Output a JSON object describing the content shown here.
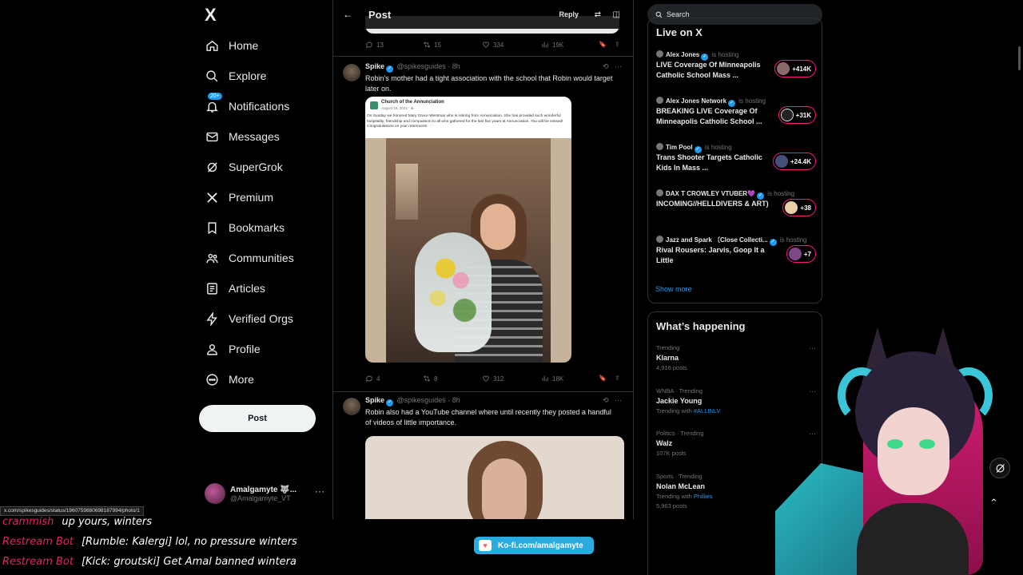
{
  "nav": {
    "logo": "X",
    "items": [
      {
        "label": "Home",
        "icon": "home-icon"
      },
      {
        "label": "Explore",
        "icon": "search-icon"
      },
      {
        "label": "Notifications",
        "icon": "bell-icon",
        "badge": "20+"
      },
      {
        "label": "Messages",
        "icon": "mail-icon"
      },
      {
        "label": "SuperGrok",
        "icon": "grok-icon"
      },
      {
        "label": "Premium",
        "icon": "x-icon"
      },
      {
        "label": "Bookmarks",
        "icon": "bookmark-icon"
      },
      {
        "label": "Communities",
        "icon": "people-icon"
      },
      {
        "label": "Articles",
        "icon": "article-icon"
      },
      {
        "label": "Verified Orgs",
        "icon": "bolt-icon"
      },
      {
        "label": "Profile",
        "icon": "person-icon"
      },
      {
        "label": "More",
        "icon": "more-circle-icon"
      }
    ],
    "post_button": "Post",
    "account": {
      "name": "Amalgamyte 🐺...",
      "handle": "@Amalgamyte_VT"
    }
  },
  "timeline": {
    "title": "Post",
    "reply_label": "Reply",
    "prev_actions": {
      "replies": "13",
      "reposts": "15",
      "likes": "334",
      "views": "19K"
    },
    "tweets": [
      {
        "name": "Spike",
        "handle": "@spikesguides",
        "time": "8h",
        "text": "Robin's mother had a tight association with the school that Robin would target later on.",
        "card": {
          "org": "Church of the Annunciation",
          "date": "August 16, 2021 · ⊕",
          "text": "On Sunday we honored Mary Grace Westman who is retiring from Annunciation. She has provided such wonderful hospitality, friendship and compassion to all who gathered for the last five years at Annunciation. You will be missed! Congratulations on your retirement!"
        },
        "actions": {
          "replies": "4",
          "reposts": "8",
          "likes": "312",
          "views": "18K"
        }
      },
      {
        "name": "Spike",
        "handle": "@spikesguides",
        "time": "8h",
        "text": "Robin also had a YouTube channel where until recently they posted a handful of videos of little importance."
      }
    ]
  },
  "right": {
    "search_placeholder": "Search",
    "live_title": "Live on X",
    "live": [
      {
        "host": "Alex Jones",
        "status": "is hosting",
        "title": "LIVE Coverage Of Minneapolis Catholic School Mass ...",
        "count": "+414K"
      },
      {
        "host": "Alex Jones Network",
        "status": "is hosting",
        "title": "BREAKING LIVE Coverage Of Minneapolis Catholic School ...",
        "count": "+31K"
      },
      {
        "host": "Tim Pool",
        "status": "is hosting",
        "title": "Trans Shooter Targets Catholic Kids In Mass ...",
        "count": "+24.4K"
      },
      {
        "host": "DAX T CROWLEY VTUBER💜",
        "status": "is hosting",
        "title": "INCOMING//HELLDIVERS & ART)",
        "count": "+38"
      },
      {
        "host": "Jazz and Spark 〔Close Collecti...",
        "status": "is hosting",
        "title": "Rival Rousers: Jarvis, Goop It a Little",
        "count": "+7"
      }
    ],
    "show_more": "Show more",
    "happening_title": "What’s happening",
    "trends": [
      {
        "category": "Trending",
        "name": "Klarna",
        "sub": "4,916 posts",
        "tag": ""
      },
      {
        "category": "WNBA · Trending",
        "name": "Jackie Young",
        "sub": "Trending with",
        "tag": "#ALLINLV"
      },
      {
        "category": "Politics · Trending",
        "name": "Walz",
        "sub": "107K posts",
        "tag": ""
      },
      {
        "category": "Sports · Trending",
        "name": "Nolan McLean",
        "sub": "Trending with",
        "tag": "Phillies",
        "extra": "5,963 posts"
      }
    ]
  },
  "status_url": "x.com/spikesguides/status/1960759880698187994/photo/1",
  "chat": [
    {
      "who": "crammish",
      "msg": "up yours, winters"
    },
    {
      "who": "Restream Bot",
      "msg": "[Rumble: Kalergi] lol, no pressure winters"
    },
    {
      "who": "Restream Bot",
      "msg": "[Kick: groutski] Get Amal banned wintera"
    }
  ],
  "kofi": "Ko-fi.com/amalgamyte",
  "colors": {
    "accent": "#1d9bf0",
    "live_pink": "#f91880",
    "chat_name": "#e0245e"
  }
}
